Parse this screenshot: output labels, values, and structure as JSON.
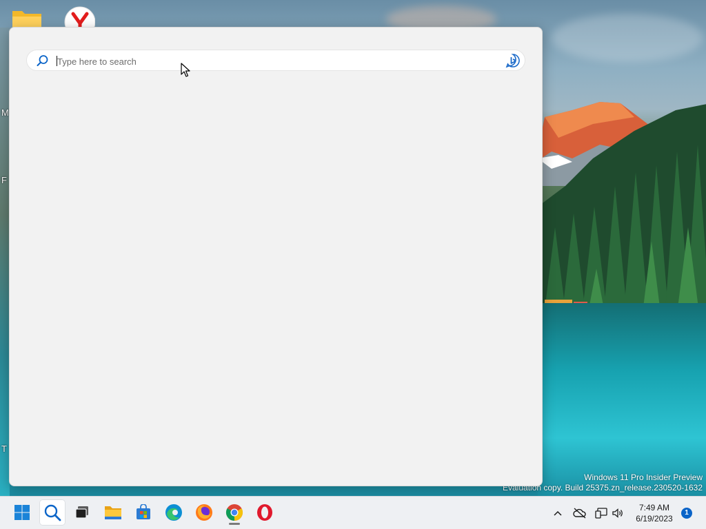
{
  "desktop": {
    "left_edge_letters": [
      "M",
      "F",
      "T"
    ],
    "icons": [
      {
        "name": "folder-icon",
        "label": ""
      },
      {
        "name": "yandex-browser-icon",
        "label": ""
      }
    ],
    "watermark": {
      "line1": "Windows 11 Pro Insider Preview",
      "line2": "Evaluation copy. Build 25375.zn_release.230520-1632"
    }
  },
  "search_panel": {
    "input": {
      "value": "",
      "placeholder": "Type here to search"
    },
    "icons": {
      "left": "search-icon",
      "right": "bing-chat-icon"
    }
  },
  "taskbar": {
    "apps": [
      {
        "name": "start-button",
        "icon": "windows-logo-icon",
        "active": false
      },
      {
        "name": "search-button",
        "icon": "search-icon",
        "active": true
      },
      {
        "name": "task-view-button",
        "icon": "task-view-icon",
        "active": false
      },
      {
        "name": "file-explorer-button",
        "icon": "folder-icon",
        "active": false
      },
      {
        "name": "microsoft-store-button",
        "icon": "store-icon",
        "active": false
      },
      {
        "name": "edge-button",
        "icon": "edge-icon",
        "active": false
      },
      {
        "name": "firefox-button",
        "icon": "firefox-icon",
        "active": false
      },
      {
        "name": "chrome-button",
        "icon": "chrome-icon",
        "active": false,
        "running": true
      },
      {
        "name": "opera-button",
        "icon": "opera-icon",
        "active": false
      }
    ],
    "tray": {
      "icons": [
        "chevron-up-icon",
        "onedrive-offline-icon",
        "network-icon",
        "volume-icon"
      ],
      "time": "7:49 AM",
      "date": "6/19/2023",
      "notification_count": "1"
    }
  },
  "colors": {
    "accent": "#0a64c8",
    "panel_bg": "#f2f2f2",
    "taskbar_bg": "#eef0f3"
  }
}
